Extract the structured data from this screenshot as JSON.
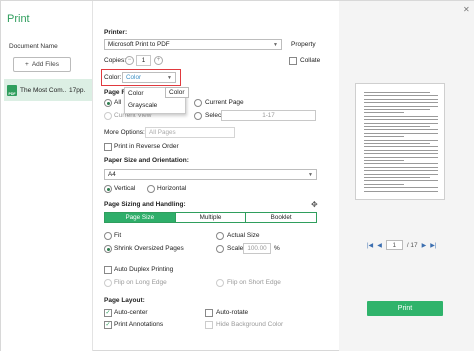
{
  "app": {
    "title": "Print"
  },
  "sidebar": {
    "doc_header": "Document Name",
    "add_files": "Add Files",
    "doc": {
      "badge": "PDF",
      "name": "The Most Com...",
      "pages": "17pp."
    }
  },
  "printer": {
    "label": "Printer:",
    "value": "Microsoft Print to PDF",
    "property": "Property",
    "copies_label": "Copies:",
    "copies_value": "1",
    "collate": "Collate"
  },
  "color": {
    "label": "Color:",
    "value": "Color",
    "options": [
      "Color",
      "Grayscale"
    ],
    "tooltip": "Color"
  },
  "page_range": {
    "label": "Page Ra",
    "all": "All",
    "current_page": "Current Page",
    "current_view": "Current View",
    "selection": "Selection",
    "selection_value": "1-17",
    "more_options_label": "More Options:",
    "more_options_value": "All Pages",
    "reverse": "Print in Reverse Order"
  },
  "paper": {
    "label": "Paper Size and Orientation:",
    "size": "A4",
    "vertical": "Vertical",
    "horizontal": "Horizontal"
  },
  "sizing": {
    "label": "Page Sizing and Handling:",
    "tabs": [
      "Page Size",
      "Multiple",
      "Booklet"
    ],
    "fit": "Fit",
    "actual_size": "Actual Size",
    "shrink": "Shrink Oversized Pages",
    "scale": "Scale",
    "scale_value": "100.00",
    "scale_unit": "%"
  },
  "duplex": {
    "auto": "Auto Duplex Printing",
    "long_edge": "Flip on Long Edge",
    "short_edge": "Flip on Short Edge"
  },
  "layout": {
    "label": "Page Layout:",
    "auto_center": "Auto-center",
    "auto_rotate": "Auto-rotate",
    "annotations": "Print Annotations",
    "hide_bg": "Hide Background Color"
  },
  "preview": {
    "page_current": "1",
    "page_total": "/ 17",
    "print_button": "Print"
  },
  "colors": {
    "accent": "#2fae6a",
    "highlight": "#e0393e"
  }
}
